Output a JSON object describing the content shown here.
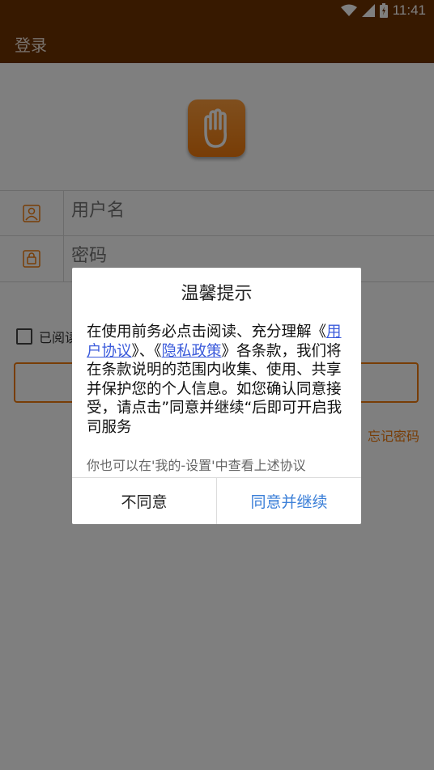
{
  "status_bar": {
    "time": "11:41"
  },
  "app_bar": {
    "title": "登录"
  },
  "login_form": {
    "username_placeholder": "用户名",
    "password_placeholder": "密码",
    "agree_text_visible": "已阅读",
    "forgot_password": "忘记密码"
  },
  "dialog": {
    "title": "温馨提示",
    "body_prefix": "在使用前务必点击阅读、充分理解《",
    "link_user_agreement": "用户协议",
    "body_mid": "》、《",
    "link_privacy_policy": "隐私政策",
    "body_suffix": "》各条款，我们将在条款说明的范围内收集、使用、共享并保护您的个人信息。如您确认同意接受，请点击”同意并继续“后即可开启我司服务",
    "hint": "你也可以在'我的-设置'中查看上述协议",
    "disagree_label": "不同意",
    "agree_label": "同意并继续"
  },
  "colors": {
    "app_bar": "#6e3300",
    "accent": "#f07a0c",
    "link": "#3b5bdb",
    "agree_button": "#3b7fd8"
  },
  "icons": [
    "wifi-icon",
    "signal-icon",
    "battery-icon",
    "hand-logo-icon",
    "user-icon",
    "lock-icon",
    "checkbox-icon"
  ]
}
